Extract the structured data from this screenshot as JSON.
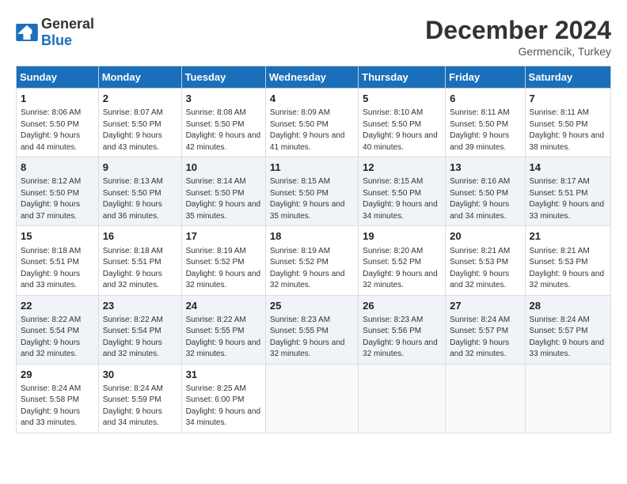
{
  "header": {
    "logo_general": "General",
    "logo_blue": "Blue",
    "month": "December 2024",
    "location": "Germencik, Turkey"
  },
  "weekdays": [
    "Sunday",
    "Monday",
    "Tuesday",
    "Wednesday",
    "Thursday",
    "Friday",
    "Saturday"
  ],
  "weeks": [
    [
      {
        "day": "1",
        "sunrise": "Sunrise: 8:06 AM",
        "sunset": "Sunset: 5:50 PM",
        "daylight": "Daylight: 9 hours and 44 minutes."
      },
      {
        "day": "2",
        "sunrise": "Sunrise: 8:07 AM",
        "sunset": "Sunset: 5:50 PM",
        "daylight": "Daylight: 9 hours and 43 minutes."
      },
      {
        "day": "3",
        "sunrise": "Sunrise: 8:08 AM",
        "sunset": "Sunset: 5:50 PM",
        "daylight": "Daylight: 9 hours and 42 minutes."
      },
      {
        "day": "4",
        "sunrise": "Sunrise: 8:09 AM",
        "sunset": "Sunset: 5:50 PM",
        "daylight": "Daylight: 9 hours and 41 minutes."
      },
      {
        "day": "5",
        "sunrise": "Sunrise: 8:10 AM",
        "sunset": "Sunset: 5:50 PM",
        "daylight": "Daylight: 9 hours and 40 minutes."
      },
      {
        "day": "6",
        "sunrise": "Sunrise: 8:11 AM",
        "sunset": "Sunset: 5:50 PM",
        "daylight": "Daylight: 9 hours and 39 minutes."
      },
      {
        "day": "7",
        "sunrise": "Sunrise: 8:11 AM",
        "sunset": "Sunset: 5:50 PM",
        "daylight": "Daylight: 9 hours and 38 minutes."
      }
    ],
    [
      {
        "day": "8",
        "sunrise": "Sunrise: 8:12 AM",
        "sunset": "Sunset: 5:50 PM",
        "daylight": "Daylight: 9 hours and 37 minutes."
      },
      {
        "day": "9",
        "sunrise": "Sunrise: 8:13 AM",
        "sunset": "Sunset: 5:50 PM",
        "daylight": "Daylight: 9 hours and 36 minutes."
      },
      {
        "day": "10",
        "sunrise": "Sunrise: 8:14 AM",
        "sunset": "Sunset: 5:50 PM",
        "daylight": "Daylight: 9 hours and 35 minutes."
      },
      {
        "day": "11",
        "sunrise": "Sunrise: 8:15 AM",
        "sunset": "Sunset: 5:50 PM",
        "daylight": "Daylight: 9 hours and 35 minutes."
      },
      {
        "day": "12",
        "sunrise": "Sunrise: 8:15 AM",
        "sunset": "Sunset: 5:50 PM",
        "daylight": "Daylight: 9 hours and 34 minutes."
      },
      {
        "day": "13",
        "sunrise": "Sunrise: 8:16 AM",
        "sunset": "Sunset: 5:50 PM",
        "daylight": "Daylight: 9 hours and 34 minutes."
      },
      {
        "day": "14",
        "sunrise": "Sunrise: 8:17 AM",
        "sunset": "Sunset: 5:51 PM",
        "daylight": "Daylight: 9 hours and 33 minutes."
      }
    ],
    [
      {
        "day": "15",
        "sunrise": "Sunrise: 8:18 AM",
        "sunset": "Sunset: 5:51 PM",
        "daylight": "Daylight: 9 hours and 33 minutes."
      },
      {
        "day": "16",
        "sunrise": "Sunrise: 8:18 AM",
        "sunset": "Sunset: 5:51 PM",
        "daylight": "Daylight: 9 hours and 32 minutes."
      },
      {
        "day": "17",
        "sunrise": "Sunrise: 8:19 AM",
        "sunset": "Sunset: 5:52 PM",
        "daylight": "Daylight: 9 hours and 32 minutes."
      },
      {
        "day": "18",
        "sunrise": "Sunrise: 8:19 AM",
        "sunset": "Sunset: 5:52 PM",
        "daylight": "Daylight: 9 hours and 32 minutes."
      },
      {
        "day": "19",
        "sunrise": "Sunrise: 8:20 AM",
        "sunset": "Sunset: 5:52 PM",
        "daylight": "Daylight: 9 hours and 32 minutes."
      },
      {
        "day": "20",
        "sunrise": "Sunrise: 8:21 AM",
        "sunset": "Sunset: 5:53 PM",
        "daylight": "Daylight: 9 hours and 32 minutes."
      },
      {
        "day": "21",
        "sunrise": "Sunrise: 8:21 AM",
        "sunset": "Sunset: 5:53 PM",
        "daylight": "Daylight: 9 hours and 32 minutes."
      }
    ],
    [
      {
        "day": "22",
        "sunrise": "Sunrise: 8:22 AM",
        "sunset": "Sunset: 5:54 PM",
        "daylight": "Daylight: 9 hours and 32 minutes."
      },
      {
        "day": "23",
        "sunrise": "Sunrise: 8:22 AM",
        "sunset": "Sunset: 5:54 PM",
        "daylight": "Daylight: 9 hours and 32 minutes."
      },
      {
        "day": "24",
        "sunrise": "Sunrise: 8:22 AM",
        "sunset": "Sunset: 5:55 PM",
        "daylight": "Daylight: 9 hours and 32 minutes."
      },
      {
        "day": "25",
        "sunrise": "Sunrise: 8:23 AM",
        "sunset": "Sunset: 5:55 PM",
        "daylight": "Daylight: 9 hours and 32 minutes."
      },
      {
        "day": "26",
        "sunrise": "Sunrise: 8:23 AM",
        "sunset": "Sunset: 5:56 PM",
        "daylight": "Daylight: 9 hours and 32 minutes."
      },
      {
        "day": "27",
        "sunrise": "Sunrise: 8:24 AM",
        "sunset": "Sunset: 5:57 PM",
        "daylight": "Daylight: 9 hours and 32 minutes."
      },
      {
        "day": "28",
        "sunrise": "Sunrise: 8:24 AM",
        "sunset": "Sunset: 5:57 PM",
        "daylight": "Daylight: 9 hours and 33 minutes."
      }
    ],
    [
      {
        "day": "29",
        "sunrise": "Sunrise: 8:24 AM",
        "sunset": "Sunset: 5:58 PM",
        "daylight": "Daylight: 9 hours and 33 minutes."
      },
      {
        "day": "30",
        "sunrise": "Sunrise: 8:24 AM",
        "sunset": "Sunset: 5:59 PM",
        "daylight": "Daylight: 9 hours and 34 minutes."
      },
      {
        "day": "31",
        "sunrise": "Sunrise: 8:25 AM",
        "sunset": "Sunset: 6:00 PM",
        "daylight": "Daylight: 9 hours and 34 minutes."
      },
      null,
      null,
      null,
      null
    ]
  ]
}
